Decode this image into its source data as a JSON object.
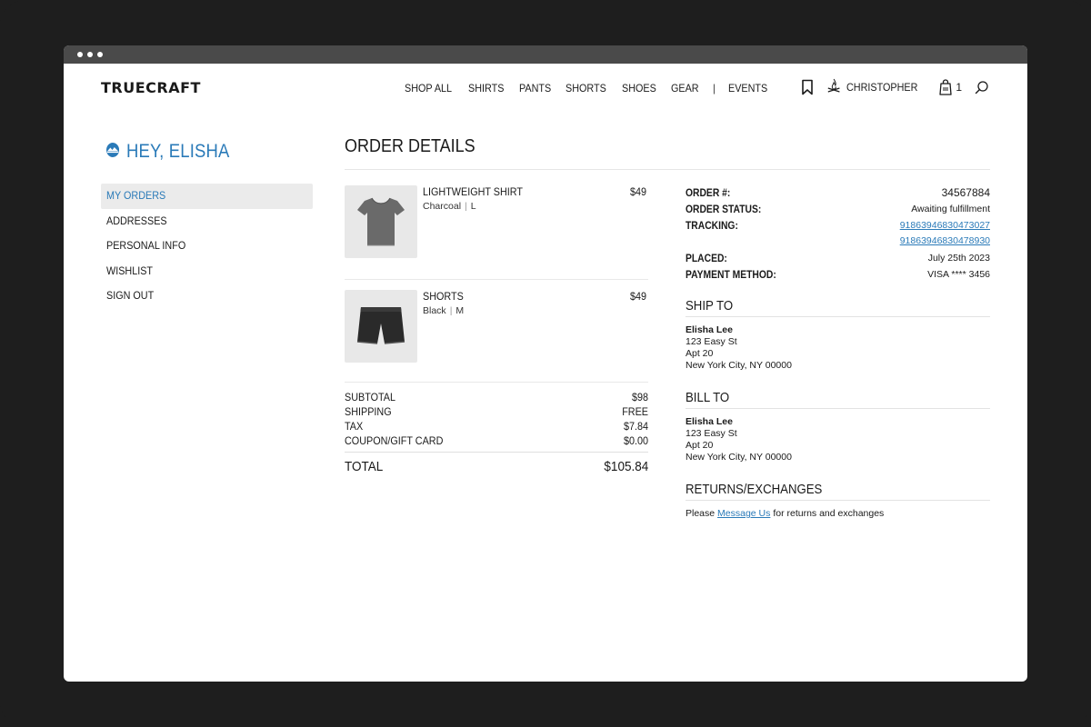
{
  "brand": {
    "logo": "TRUECRAFT"
  },
  "nav": {
    "items": [
      "SHOP ALL",
      "SHIRTS",
      "PANTS",
      "SHORTS",
      "SHOES",
      "GEAR"
    ],
    "separator": "|",
    "events": "EVENTS"
  },
  "header": {
    "username": "CHRISTOPHER",
    "cart_count": "1"
  },
  "sidebar": {
    "greeting": "HEY, ELISHA",
    "items": [
      {
        "label": "MY ORDERS",
        "active": true
      },
      {
        "label": "ADDRESSES"
      },
      {
        "label": "PERSONAL INFO"
      },
      {
        "label": "WISHLIST"
      },
      {
        "label": "SIGN OUT"
      }
    ]
  },
  "page": {
    "title": "ORDER DETAILS"
  },
  "order_items": [
    {
      "name": "LIGHTWEIGHT SHIRT",
      "color": "Charcoal",
      "size": "L",
      "price": "$49",
      "icon": "tshirt-image"
    },
    {
      "name": "SHORTS",
      "color": "Black",
      "size": "M",
      "price": "$49",
      "icon": "shorts-image"
    }
  ],
  "summary": {
    "subtotal_label": "SUBTOTAL",
    "subtotal": "$98",
    "shipping_label": "SHIPPING",
    "shipping": "FREE",
    "tax_label": "TAX",
    "tax": "$7.84",
    "coupon_label": "COUPON/GIFT CARD",
    "coupon": "$0.00",
    "total_label": "TOTAL",
    "total": "$105.84"
  },
  "details": {
    "order_no_label": "ORDER #:",
    "order_no": "34567884",
    "status_label": "ORDER STATUS:",
    "status": "Awaiting fulfillment",
    "tracking_label": "TRACKING:",
    "tracking": [
      "91863946830473027",
      "91863946830478930"
    ],
    "placed_label": "PLACED:",
    "placed": "July 25th 2023",
    "payment_label": "PAYMENT METHOD:",
    "payment": "VISA **** 3456"
  },
  "ship_to": {
    "title": "SHIP TO",
    "name": "Elisha Lee",
    "line1": "123 Easy St",
    "line2": "Apt 20",
    "city": "New York City, NY 00000"
  },
  "bill_to": {
    "title": "BILL TO",
    "name": "Elisha Lee",
    "line1": "123 Easy St",
    "line2": "Apt 20",
    "city": "New York City, NY 00000"
  },
  "returns": {
    "title": "RETURNS/EXCHANGES",
    "prefix": "Please",
    "link": "Message Us",
    "suffix": "for returns and exchanges"
  },
  "colors": {
    "accent": "#2a7ab8",
    "active_bg": "#ebebeb"
  }
}
